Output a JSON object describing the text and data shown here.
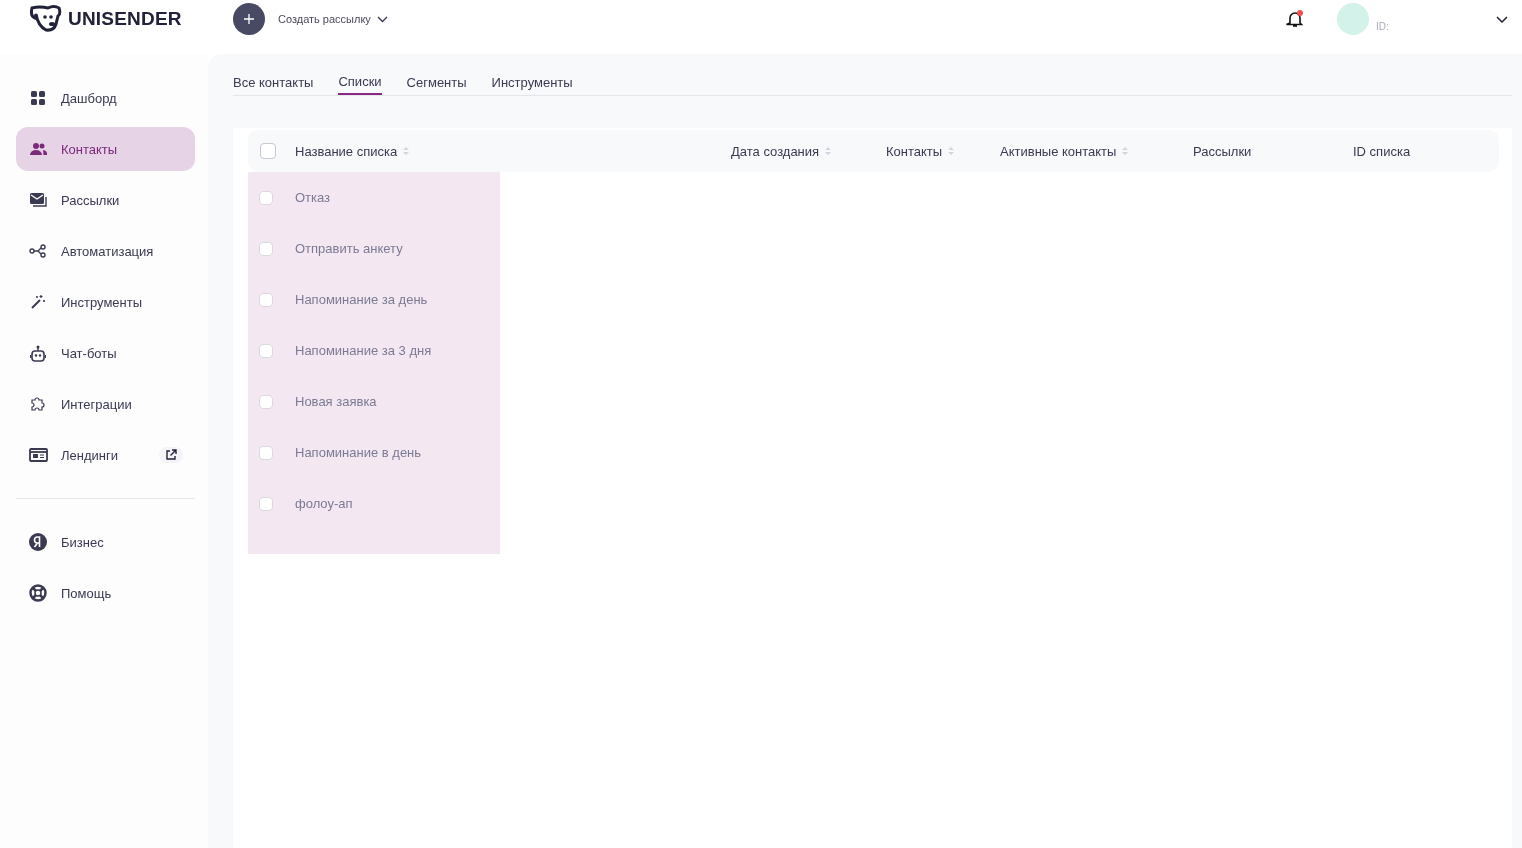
{
  "header": {
    "logo": "UNISENDER",
    "create_button": "Создать рассылку",
    "notifications": {
      "unread": true
    },
    "account": {
      "id_label": "ID:"
    }
  },
  "sidebar": {
    "items": [
      {
        "label": "Дашборд",
        "selected": false,
        "external": false
      },
      {
        "label": "Контакты",
        "selected": true,
        "external": false
      },
      {
        "label": "Рассылки",
        "selected": false,
        "external": false
      },
      {
        "label": "Автоматизация",
        "selected": false,
        "external": false
      },
      {
        "label": "Инструменты",
        "selected": false,
        "external": false
      },
      {
        "label": "Чат-боты",
        "selected": false,
        "external": false
      },
      {
        "label": "Интеграции",
        "selected": false,
        "external": false
      },
      {
        "label": "Лендинги",
        "selected": false,
        "external": true
      }
    ],
    "bottom_items": [
      {
        "label": "Бизнес",
        "selected": false
      },
      {
        "label": "Помощь",
        "selected": false
      }
    ]
  },
  "tabs": [
    {
      "label": "Все контакты",
      "selected": false
    },
    {
      "label": "Списки",
      "selected": true
    },
    {
      "label": "Сегменты",
      "selected": false
    },
    {
      "label": "Инструменты",
      "selected": false
    }
  ],
  "table": {
    "select_all": {
      "checked": false
    },
    "columns": [
      {
        "label": "Название списка",
        "sortable": true
      },
      {
        "label": "Дата создания",
        "sortable": true
      },
      {
        "label": "Контакты",
        "sortable": true
      },
      {
        "label": "Активные контакты",
        "sortable": true
      },
      {
        "label": "Рассылки",
        "sortable": false
      },
      {
        "label": "ID списка",
        "sortable": false
      }
    ],
    "rows": [
      {
        "name": "Отказ",
        "checked": false
      },
      {
        "name": "Отправить анкету",
        "checked": false
      },
      {
        "name": "Напоминание за день",
        "checked": false
      },
      {
        "name": "Напоминание за 3 дня",
        "checked": false
      },
      {
        "name": "Новая заявка",
        "checked": false
      },
      {
        "name": "Напоминание в день",
        "checked": false
      },
      {
        "name": "фолоу-ап",
        "checked": false
      }
    ]
  }
}
